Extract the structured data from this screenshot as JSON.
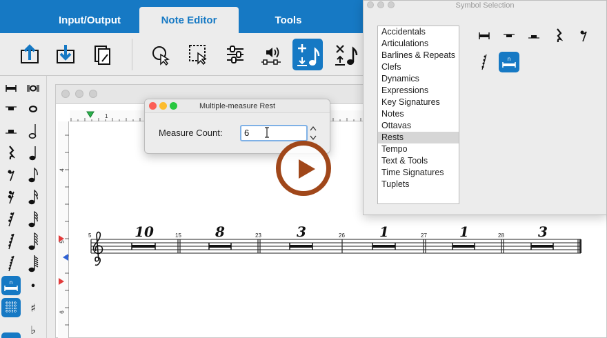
{
  "tabs": [
    {
      "label": "Input/Output",
      "active": false
    },
    {
      "label": "Note Editor",
      "active": true
    },
    {
      "label": "Tools",
      "active": false
    }
  ],
  "toolbar": {
    "icons": [
      "import-icon",
      "export-icon",
      "page-edit-icon",
      "select-pointer-icon",
      "marquee-select-icon",
      "mixer-sliders-icon",
      "playback-speaker-icon",
      "add-note-icon",
      "delete-note-icon"
    ],
    "selected": "add-note-icon"
  },
  "palette": {
    "selected": "multimeasure-rest-icon",
    "glyphs": {
      "dot": "•",
      "sharp": "♯",
      "flat": "♭"
    }
  },
  "dialog": {
    "title": "Multiple-measure Rest",
    "label": "Measure Count:",
    "value": "6"
  },
  "symbol_selection": {
    "title": "Symbol Selection",
    "categories": [
      "Accidentals",
      "Articulations",
      "Barlines & Repeats",
      "Clefs",
      "Dynamics",
      "Expressions",
      "Key Signatures",
      "Notes",
      "Ottavas",
      "Rests",
      "Tempo",
      "Text & Tools",
      "Time Signatures",
      "Tuplets"
    ],
    "selected_category": "Rests",
    "selected_symbol": "multimeasure-rest-icon"
  },
  "ruler": {
    "h_number": "1",
    "v_numbers": [
      "4",
      "5",
      "6"
    ]
  },
  "score": {
    "measures": [
      {
        "start": "5",
        "count": "10"
      },
      {
        "start": "15",
        "count": "8"
      },
      {
        "start": "23",
        "count": "3"
      },
      {
        "start": "26",
        "count": "1"
      },
      {
        "start": "27",
        "count": "1"
      },
      {
        "start": "28",
        "count": "3"
      }
    ]
  },
  "colors": {
    "accent": "#1679c4",
    "play": "#a0471a",
    "close": "#fc5f57",
    "minimize": "#fdbc2e",
    "zoom": "#28c840"
  }
}
